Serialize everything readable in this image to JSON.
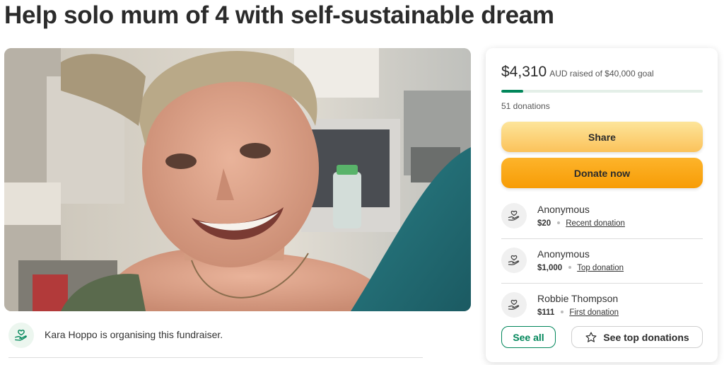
{
  "campaign": {
    "title": "Help solo mum of 4 with self-sustainable dream"
  },
  "organiser": {
    "text": "Kara Hoppo is organising this fundraiser."
  },
  "donation_card": {
    "amount_raised": "$4,310",
    "goal_text": "AUD raised of $40,000 goal",
    "progress_fraction": 0.108,
    "donation_count": "51 donations",
    "share_label": "Share",
    "donate_label": "Donate now",
    "donors": [
      {
        "name": "Anonymous",
        "amount": "$20",
        "tag": "Recent donation"
      },
      {
        "name": "Anonymous",
        "amount": "$1,000",
        "tag": "Top donation"
      },
      {
        "name": "Robbie Thompson",
        "amount": "$111",
        "tag": "First donation"
      }
    ],
    "see_all_label": "See all",
    "see_top_label": "See top donations"
  },
  "colors": {
    "brand_green": "#01865a",
    "share_yellow": "#fbc25a",
    "donate_orange": "#f79c05"
  },
  "icons": {
    "donor": "heart-hand-icon",
    "organiser": "heart-hand-icon",
    "top_donations": "star-outline-icon"
  }
}
